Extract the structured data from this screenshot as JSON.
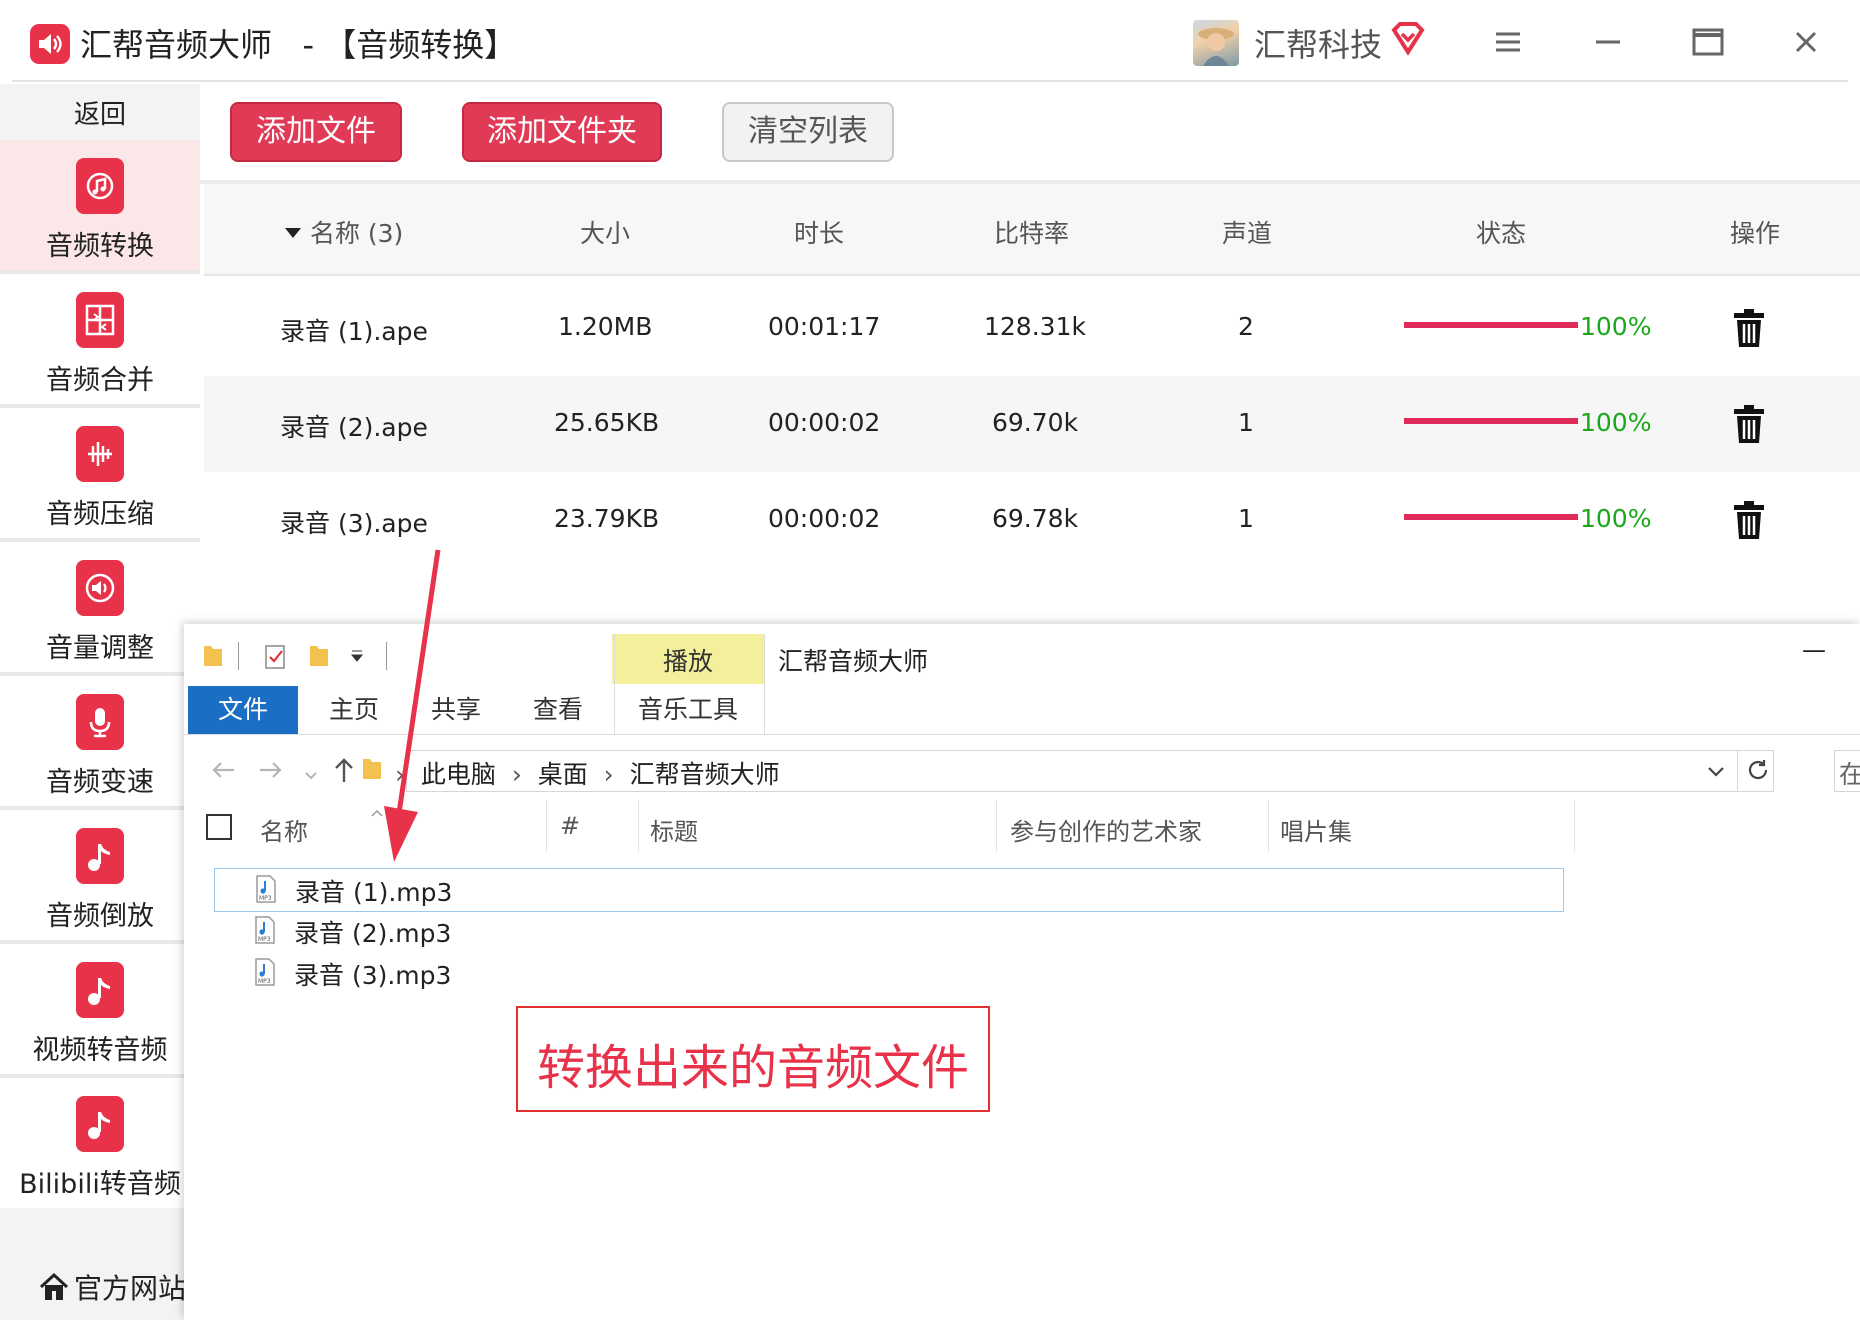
{
  "window": {
    "app_title": "汇帮音频大师",
    "separator": "-",
    "page_title": "【音频转换】",
    "user_name": "汇帮科技"
  },
  "sidebar": {
    "back_label": "返回",
    "items": [
      {
        "label": "音频转换",
        "icon": "music-convert-icon",
        "active": true
      },
      {
        "label": "音频合并",
        "icon": "merge-icon"
      },
      {
        "label": "音频压缩",
        "icon": "waveform-icon"
      },
      {
        "label": "音量调整",
        "icon": "speaker-icon"
      },
      {
        "label": "音频变速",
        "icon": "microphone-icon"
      },
      {
        "label": "音频倒放",
        "icon": "music-note-icon"
      },
      {
        "label": "视频转音频",
        "icon": "music-note-icon"
      },
      {
        "label": "Bilibili转音频",
        "icon": "music-note-icon"
      }
    ],
    "official_site_label": "官方网站"
  },
  "toolbar": {
    "add_file": "添加文件",
    "add_folder": "添加文件夹",
    "clear_list": "清空列表"
  },
  "file_table": {
    "columns": {
      "name": "名称 (3)",
      "size": "大小",
      "duration": "时长",
      "bitrate": "比特率",
      "channels": "声道",
      "status": "状态",
      "action": "操作"
    },
    "rows": [
      {
        "name": "录音 (1).ape",
        "size": "1.20MB",
        "duration": "00:01:17",
        "bitrate": "128.31k",
        "channels": "2",
        "progress": 1.0,
        "status": "100%"
      },
      {
        "name": "录音 (2).ape",
        "size": "25.65KB",
        "duration": "00:00:02",
        "bitrate": "69.70k",
        "channels": "1",
        "progress": 1.0,
        "status": "100%"
      },
      {
        "name": "录音 (3).ape",
        "size": "23.79KB",
        "duration": "00:00:02",
        "bitrate": "69.78k",
        "channels": "1",
        "progress": 1.0,
        "status": "100%"
      }
    ]
  },
  "explorer": {
    "context_tab": "播放",
    "context_group": "音乐工具",
    "window_title": "汇帮音频大师",
    "minimize": "—",
    "tabs": {
      "file": "文件",
      "home": "主页",
      "share": "共享",
      "view": "查看"
    },
    "breadcrumb": [
      "此电脑",
      "桌面",
      "汇帮音频大师"
    ],
    "search_stub": "在",
    "columns": {
      "name": "名称",
      "number": "#",
      "title": "标题",
      "artist": "参与创作的艺术家",
      "album": "唱片集"
    },
    "files": [
      "录音 (1).mp3",
      "录音 (2).mp3",
      "录音 (3).mp3"
    ]
  },
  "annotation": {
    "text": "转换出来的音频文件",
    "color": "#e8324a"
  },
  "colors": {
    "accent": "#e03a57",
    "progress": "#e02a5a",
    "success": "#1aa81a",
    "explorer_blue": "#1a6fc4"
  }
}
